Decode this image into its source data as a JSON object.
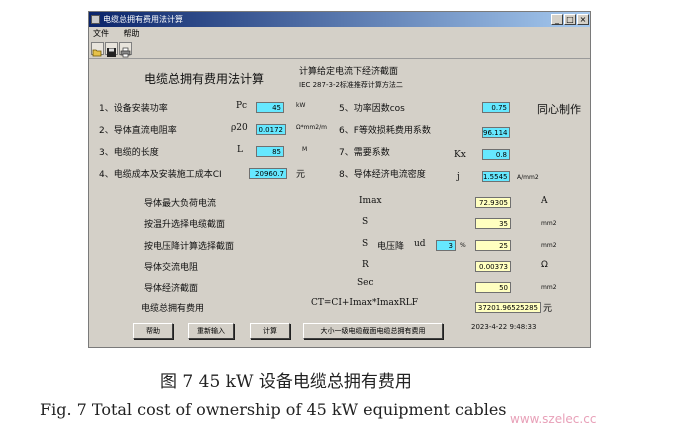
{
  "window": {
    "title": "电缆总拥有费用法计算"
  },
  "titlebar_buttons": [
    "_",
    "□",
    "×"
  ],
  "menu": [
    "文件",
    "帮助"
  ],
  "toolbar_icons": [
    "open-icon",
    "save-icon",
    "print-icon"
  ],
  "header": {
    "title": "电缆总拥有费用法计算",
    "subtitle1": "计算给定电流下经济截面",
    "subtitle2": "IEC 287-3-2标准推荐计算方法二",
    "author": "同心制作"
  },
  "params": {
    "p1": {
      "label": "1、设备安装功率",
      "sym": "Pc",
      "value": "45",
      "unit": "kW"
    },
    "p2": {
      "label": "2、导体直流电阻率",
      "sym": "ρ20",
      "value": "0.0172",
      "unit": "Ω*mm2/m"
    },
    "p3": {
      "label": "3、电缆的长度",
      "sym": "L",
      "value": "85",
      "unit": "M"
    },
    "p4": {
      "label": "4、电缆成本及安装施工成本CI",
      "value": "20960.7",
      "unit": "元"
    },
    "p5": {
      "label": "5、功率因数cos",
      "value": "0.75"
    },
    "p6": {
      "label": "6、F等效损耗费用系数",
      "value": "96.114"
    },
    "p7": {
      "label": "7、需要系数",
      "sym": "Kx",
      "value": "0.8"
    },
    "p8": {
      "label": "8、导体经济电流密度",
      "sym": "j",
      "value": "1.5545",
      "unit": "A/mm2"
    }
  },
  "results": {
    "r1": {
      "label": "导体最大负荷电流",
      "sym": "Imax",
      "value": "72.9305",
      "unit": "A"
    },
    "r2": {
      "label": "按温升选择电缆截面",
      "sym": "S",
      "value": "35",
      "unit": "mm2"
    },
    "r3": {
      "label": "按电压降计算选择截面",
      "sym": "S",
      "vd_label": "电压降",
      "vd_sym": "ud",
      "vd_value": "3",
      "vd_unit": "%",
      "value": "25",
      "unit": "mm2"
    },
    "r4": {
      "label": "导体交流电阻",
      "sym": "R",
      "value": "0.00373",
      "unit": "Ω"
    },
    "r5": {
      "label": "导体经济截面",
      "sym": "Sec",
      "value": "50",
      "unit": "mm2"
    },
    "r6": {
      "label": "电缆总拥有费用",
      "formula": "CT=CI+Imax*ImaxRLF",
      "value": "37201.96525285",
      "unit": "元"
    }
  },
  "buttons": {
    "help": "帮助",
    "reenter": "重新输入",
    "calc": "计算",
    "compare": "大小一级电缆截面电缆总拥有费用"
  },
  "timestamp": "2023-4-22 9:48:33",
  "caption": {
    "cn": "图 7   45 kW 设备电缆总拥有费用",
    "en": "Fig. 7   Total cost of ownership of 45 kW equipment cables"
  },
  "watermark": "www.szelec.cc"
}
